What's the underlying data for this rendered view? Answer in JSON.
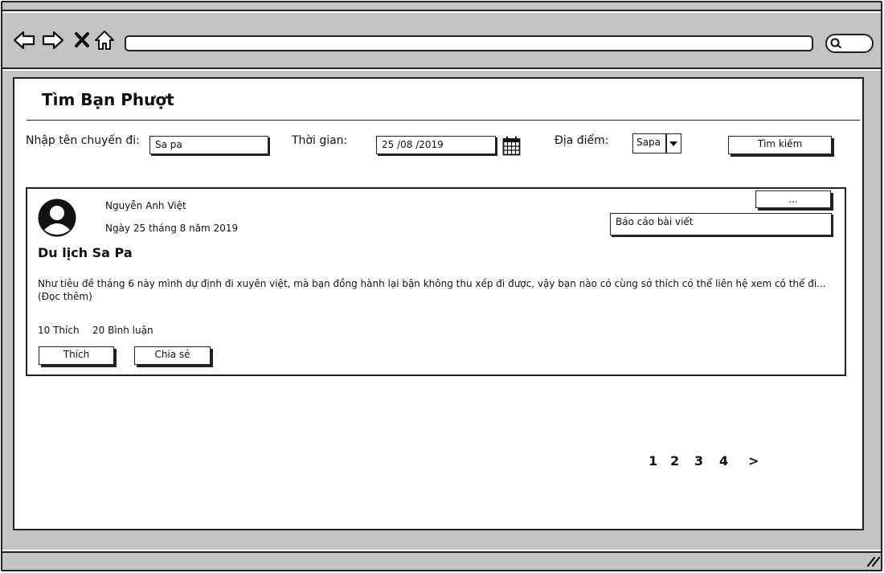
{
  "header": {
    "title": "Tìm Bạn Phượt"
  },
  "filters": {
    "trip_name_label": "Nhập tên chuyến đi:",
    "trip_name_value": "Sa pa",
    "time_label": "Thời gian:",
    "time_value": "25 /08  /2019",
    "location_label": "Địa điểm:",
    "location_value": "Sapa",
    "search_button": "Tìm kiếm"
  },
  "post": {
    "author": "Nguyễn Anh Việt",
    "date": "Ngày 25 tháng 8 năm 2019",
    "more_button": "...",
    "report_option": "Báo cáo bài viết",
    "title": "Du lịch Sa Pa",
    "body": "Như tiêu đề tháng 6 này mình dự định đi xuyên việt, mà bạn đồng hành lại bận không thu xếp đi được, vậy bạn nào có cùng sở thích có thể liên hệ xem có thể đi... (Đọc thêm)",
    "likes": "10 Thích",
    "comments": "20 Bình luận",
    "like_button": "Thích",
    "share_button": "Chia sẻ"
  },
  "pagination": {
    "pages": [
      "1",
      "2",
      "3",
      "4"
    ],
    "next": ">"
  },
  "icons": {
    "back": "back-arrow-icon",
    "forward": "forward-arrow-icon",
    "close": "close-icon",
    "home": "home-icon",
    "search": "search-icon",
    "calendar": "calendar-icon",
    "dropdown": "chevron-down-icon",
    "avatar": "user-avatar-icon",
    "resize": "resize-grip-icon"
  },
  "colors": {
    "chrome": "#c4c4c4",
    "ink": "#222222",
    "background": "#ffffff"
  }
}
